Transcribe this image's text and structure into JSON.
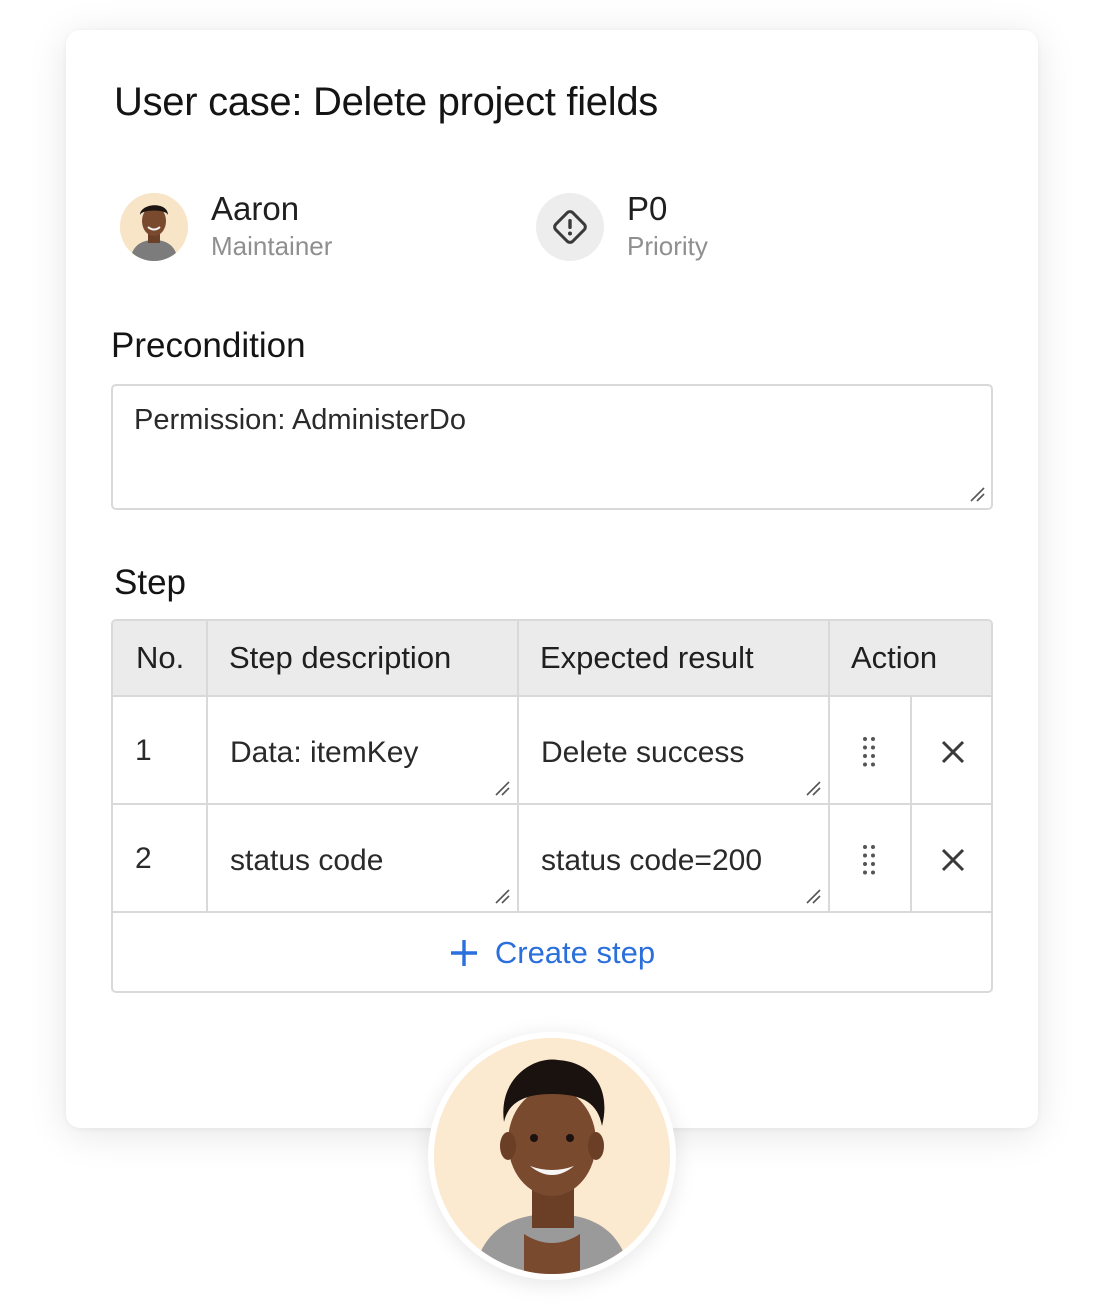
{
  "card": {
    "title": "User case: Delete project fields",
    "owner": {
      "name": "Aaron",
      "role": "Maintainer",
      "avatar_icon": "person-avatar"
    },
    "priority": {
      "level": "P0",
      "label": "Priority",
      "icon": "priority-diamond-exclamation-icon"
    },
    "precondition": {
      "label": "Precondition",
      "value": "Permission: AdministerDo"
    },
    "step": {
      "label": "Step",
      "columns": [
        "No.",
        "Step description",
        "Expected result",
        "Action"
      ],
      "rows": [
        {
          "no": "1",
          "description": "Data: itemKey",
          "expected": "Delete success"
        },
        {
          "no": "2",
          "description": "status code",
          "expected": "status code=200"
        }
      ],
      "create_label": "Create step"
    }
  },
  "colors": {
    "accent": "#2a6fdb",
    "header_bg": "#ebebeb",
    "border": "#d9d9d9",
    "muted_text": "#8f8f8f",
    "avatar_bg": "#fbe9d0"
  }
}
